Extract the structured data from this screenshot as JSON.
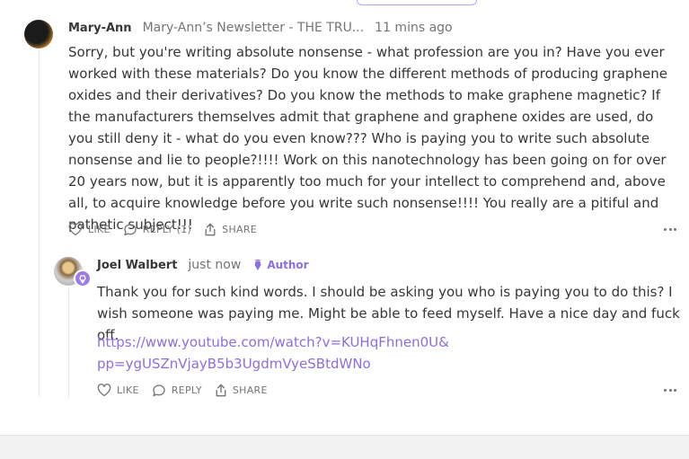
{
  "comment": {
    "author": "Mary-Ann",
    "publication": "Mary-Ann’s Newsletter - THE TRU...",
    "time": "11 mins ago",
    "body": "Sorry, but you're writing absolute nonsense - what profession are you in? Have you ever worked with these materials? Do you know the different methods of producing graphene oxides and their derivatives? Do you know the methods to make graphene magnetic? If the manufacturers themselves admit that graphene and graphene oxides are used, do you still deny it - what do you even know??? Who is paying you to write such absolute nonsense and lie to people?!!!! Work on this nanotechnology has been going on for over 20 years now, but it is apparently too much for your intellect to comprehend and, above all, to acquire knowledge before you write such nonsense!!!! You really are a pitiful and pathetic subject!!!",
    "actions": {
      "like": "LIKE",
      "reply": "REPLY (1)",
      "share": "SHARE"
    }
  },
  "reply": {
    "author": "Joel Walbert",
    "time": "just now",
    "author_tag": "Author",
    "body": "Thank you for such kind words. I should be asking you who is paying you to do this? I wish someone was paying me. Might be able to feed myself. Have a nice day and fuck off.",
    "link": "https://www.youtube.com/watch?v=KUHqFhnen0U&\npp=ygUSZnVjayB5b3UgdmVyeSBtdWNo",
    "actions": {
      "like": "LIKE",
      "reply": "REPLY",
      "share": "SHARE"
    }
  },
  "icons": {
    "like": "heart-icon",
    "reply": "comment-bubble-icon",
    "share": "share-icon",
    "more": "ellipsis-icon",
    "author": "pen-nib-icon"
  },
  "colors": {
    "accent": "#8c6ee0",
    "text": "#363737",
    "muted": "#757575"
  }
}
